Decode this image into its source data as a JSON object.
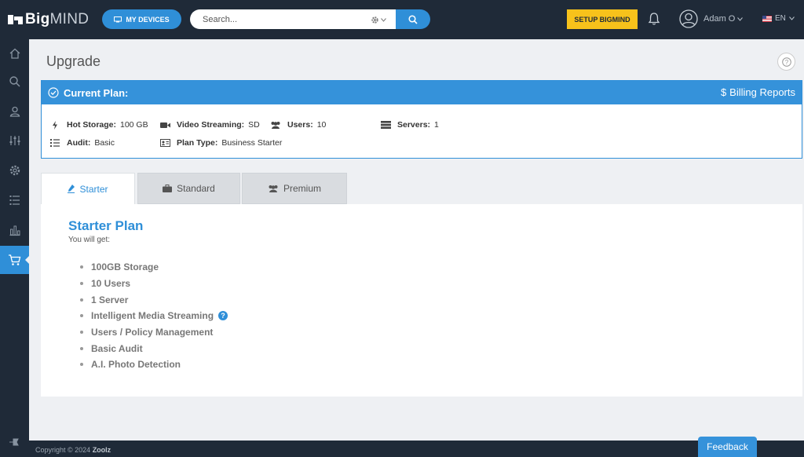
{
  "brand": {
    "name_bold": "Big",
    "name_light": "MIND"
  },
  "header": {
    "devices_label": "MY DEVICES",
    "search_placeholder": "Search...",
    "setup_label": "SETUP BIGMIND",
    "user_name": "Adam O",
    "language": "EN"
  },
  "sidebar": {
    "items": [
      {
        "icon": "home-icon"
      },
      {
        "icon": "search-icon"
      },
      {
        "icon": "users-icon"
      },
      {
        "icon": "sliders-icon"
      },
      {
        "icon": "gear-icon"
      },
      {
        "icon": "list-icon"
      },
      {
        "icon": "bar-chart-icon"
      },
      {
        "icon": "cart-icon",
        "active": true
      }
    ]
  },
  "page": {
    "title": "Upgrade"
  },
  "current_plan": {
    "title": "Current Plan:",
    "billing_label": "Billing Reports",
    "specs": [
      {
        "label": "Hot Storage:",
        "value": "100 GB"
      },
      {
        "label": "Video Streaming:",
        "value": "SD"
      },
      {
        "label": "Users:",
        "value": "10"
      },
      {
        "label": "Servers:",
        "value": "1"
      },
      {
        "label": "Audit:",
        "value": "Basic"
      },
      {
        "label": "Plan Type:",
        "value": "Business Starter"
      }
    ]
  },
  "tabs": [
    {
      "label": "Starter",
      "active": true
    },
    {
      "label": "Standard"
    },
    {
      "label": "Premium"
    }
  ],
  "plan_detail": {
    "title": "Starter Plan",
    "subtitle": "You will get:",
    "features": [
      "100GB Storage",
      "10 Users",
      "1 Server",
      "Intelligent Media Streaming",
      "Users / Policy Management",
      "Basic Audit",
      "A.I. Photo Detection"
    ]
  },
  "footer": {
    "copyright_prefix": "Copyright © 2024",
    "company": "Zoolz",
    "feedback_label": "Feedback"
  },
  "colors": {
    "accent": "#2f8fd8",
    "navbar": "#1f2a38",
    "setup": "#f7c21b"
  }
}
